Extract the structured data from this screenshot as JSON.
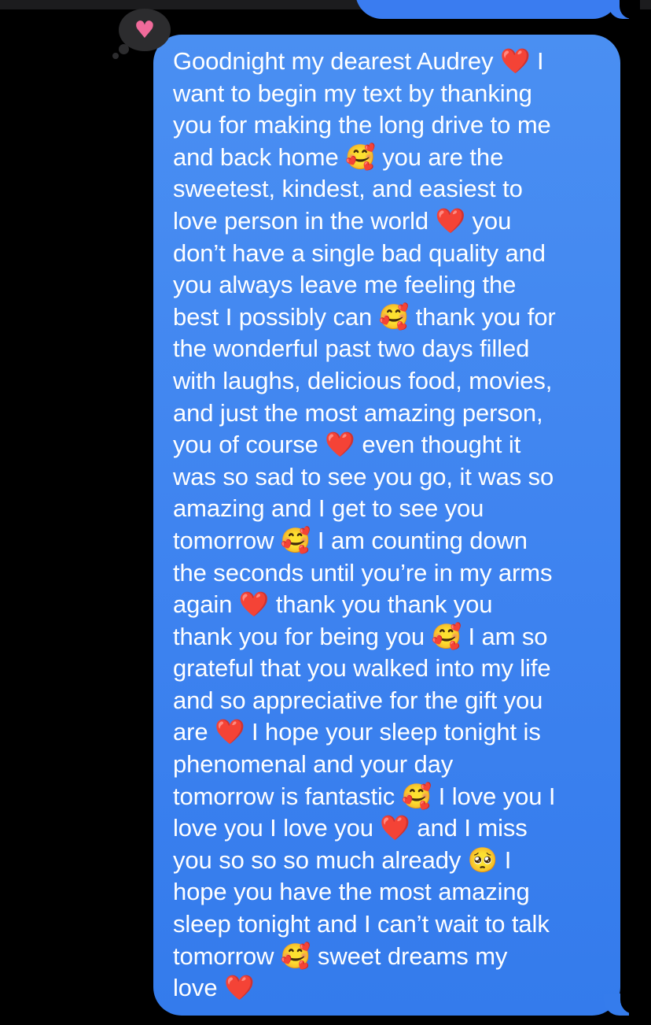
{
  "conversation": {
    "tapback": {
      "icon": "heart-icon",
      "glyph": "♥",
      "color": "#f06a9a"
    },
    "message": {
      "bubble_color": "#3f84f0",
      "text_color": "#ffffff",
      "lines": [
        "Goodnight my dearest Audrey ❤️ I",
        "want to begin my text by thanking",
        "you for making the long drive to me",
        "and back home 🥰 you are the",
        "sweetest, kindest, and easiest to",
        "love person in the world ❤️ you",
        "don’t have a single bad quality and",
        "you always leave me feeling the",
        "best I possibly can 🥰 thank you for",
        "the wonderful past two days filled",
        "with laughs, delicious food, movies,",
        "and just the most amazing person,",
        "you of course ❤️ even thought it",
        "was so sad to see you go, it was so",
        "amazing and I get to see you",
        "tomorrow 🥰 I am counting down",
        "the seconds until you’re in my arms",
        "again ❤️ thank you thank you",
        "thank you for being you 🥰 I am so",
        "grateful that you walked into my life",
        "and so appreciative for the gift you",
        "are ❤️ I hope your sleep tonight is",
        "phenomenal and your day",
        "tomorrow is fantastic 🥰 I love you I",
        "love you I love you ❤️ and I miss",
        "you so so so much already 🥺 I",
        "hope you have the most amazing",
        "sleep tonight and I can’t wait to talk",
        "tomorrow 🥰 sweet dreams my",
        "love ❤️"
      ]
    }
  }
}
